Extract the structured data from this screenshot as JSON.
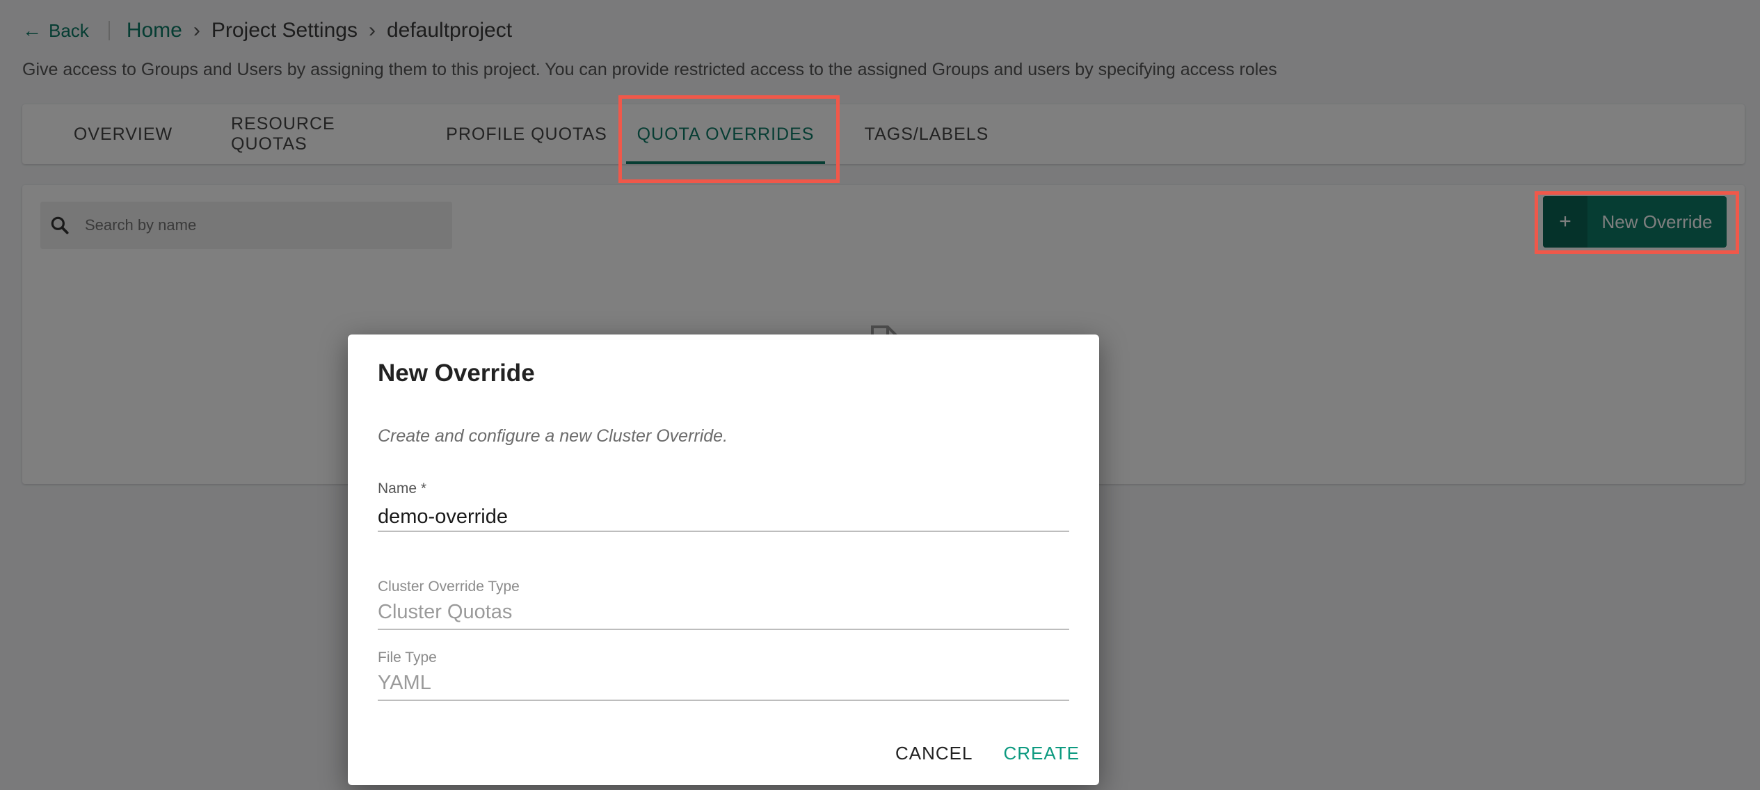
{
  "nav": {
    "back_label": "Back",
    "breadcrumb": [
      "Home",
      "Project Settings",
      "defaultproject"
    ],
    "separator": "›"
  },
  "page": {
    "description": "Give access to Groups and Users by assigning them to this project. You can provide restricted access to the assigned Groups and users by specifying access roles"
  },
  "tabs": [
    {
      "label": "OVERVIEW",
      "active": false
    },
    {
      "label": "RESOURCE QUOTAS",
      "active": false
    },
    {
      "label": "PROFILE QUOTAS",
      "active": false
    },
    {
      "label": "QUOTA OVERRIDES",
      "active": true
    },
    {
      "label": "TAGS/LABELS",
      "active": false
    }
  ],
  "toolbar": {
    "search_placeholder": "Search by name",
    "new_button_icon": "+",
    "new_button_label": "New Override"
  },
  "dialog": {
    "title": "New Override",
    "description": "Create and configure a new Cluster Override.",
    "fields": {
      "name": {
        "label": "Name *",
        "value": "demo-override"
      },
      "override_type": {
        "label": "Cluster Override Type",
        "value": "Cluster Quotas"
      },
      "file_type": {
        "label": "File Type",
        "value": "YAML"
      }
    },
    "cancel_label": "CANCEL",
    "create_label": "CREATE"
  },
  "colors": {
    "accent": "#0d7a66",
    "highlight": "#f0584a",
    "overlay": "rgba(0,0,0,0.5)"
  }
}
